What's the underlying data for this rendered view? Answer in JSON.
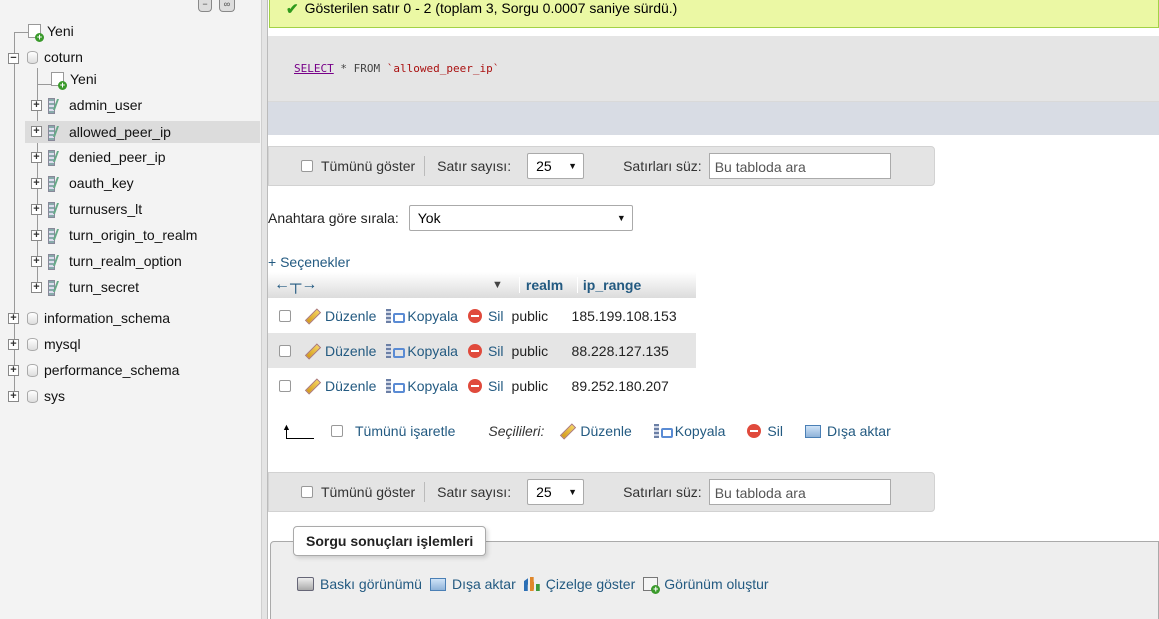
{
  "navigation": {
    "tree": [
      {
        "label": "Yeni",
        "type": "new",
        "level": 0
      },
      {
        "label": "coturn",
        "type": "database",
        "level": 0,
        "expanded": true
      },
      {
        "label": "Yeni",
        "type": "new",
        "level": 1
      },
      {
        "label": "admin_user",
        "type": "table",
        "level": 1
      },
      {
        "label": "allowed_peer_ip",
        "type": "table",
        "level": 1,
        "selected": true
      },
      {
        "label": "denied_peer_ip",
        "type": "table",
        "level": 1
      },
      {
        "label": "oauth_key",
        "type": "table",
        "level": 1
      },
      {
        "label": "turnusers_lt",
        "type": "table",
        "level": 1
      },
      {
        "label": "turn_origin_to_realm",
        "type": "table",
        "level": 1
      },
      {
        "label": "turn_realm_option",
        "type": "table",
        "level": 1
      },
      {
        "label": "turn_secret",
        "type": "table",
        "level": 1
      },
      {
        "label": "information_schema",
        "type": "database",
        "level": 0
      },
      {
        "label": "mysql",
        "type": "database",
        "level": 0
      },
      {
        "label": "performance_schema",
        "type": "database",
        "level": 0
      },
      {
        "label": "sys",
        "type": "database",
        "level": 0
      }
    ]
  },
  "message": {
    "text": "Gösterilen satır 0 - 2 (toplam 3, Sorgu 0.0007 saniye sürdü.)",
    "icon": "check-icon",
    "color": "#ebf8a4"
  },
  "sql": {
    "keyword": "SELECT",
    "middle": " * FROM ",
    "table": "`allowed_peer_ip`"
  },
  "nav_bar": {
    "show_all": "Tümünü göster",
    "row_count_label": "Satır sayısı:",
    "row_count_value": "25",
    "filter_label": "Satırları süz:",
    "filter_placeholder": "Bu tabloda ara"
  },
  "sort": {
    "label": "Anahtara göre sırala:",
    "value": "Yok"
  },
  "options_link": "+ Seçenekler",
  "table": {
    "columns": [
      "realm",
      "ip_range"
    ],
    "actions": {
      "edit": "Düzenle",
      "copy": "Kopyala",
      "delete": "Sil"
    },
    "rows": [
      {
        "realm": "public",
        "ip_range": "185.199.108.153"
      },
      {
        "realm": "public",
        "ip_range": "88.228.127.135"
      },
      {
        "realm": "public",
        "ip_range": "89.252.180.207"
      }
    ]
  },
  "bulk": {
    "check_all": "Tümünü işaretle",
    "with_selected": "Seçilileri:",
    "edit": "Düzenle",
    "copy": "Kopyala",
    "delete": "Sil",
    "export": "Dışa aktar"
  },
  "query_ops": {
    "legend": "Sorgu sonuçları işlemleri",
    "print": "Baskı görünümü",
    "export": "Dışa aktar",
    "chart": "Çizelge göster",
    "create_view": "Görünüm oluştur"
  },
  "colors": {
    "link": "#235a81",
    "success_bg": "#ebf8a4",
    "row_alt": "#e5e5e5"
  }
}
